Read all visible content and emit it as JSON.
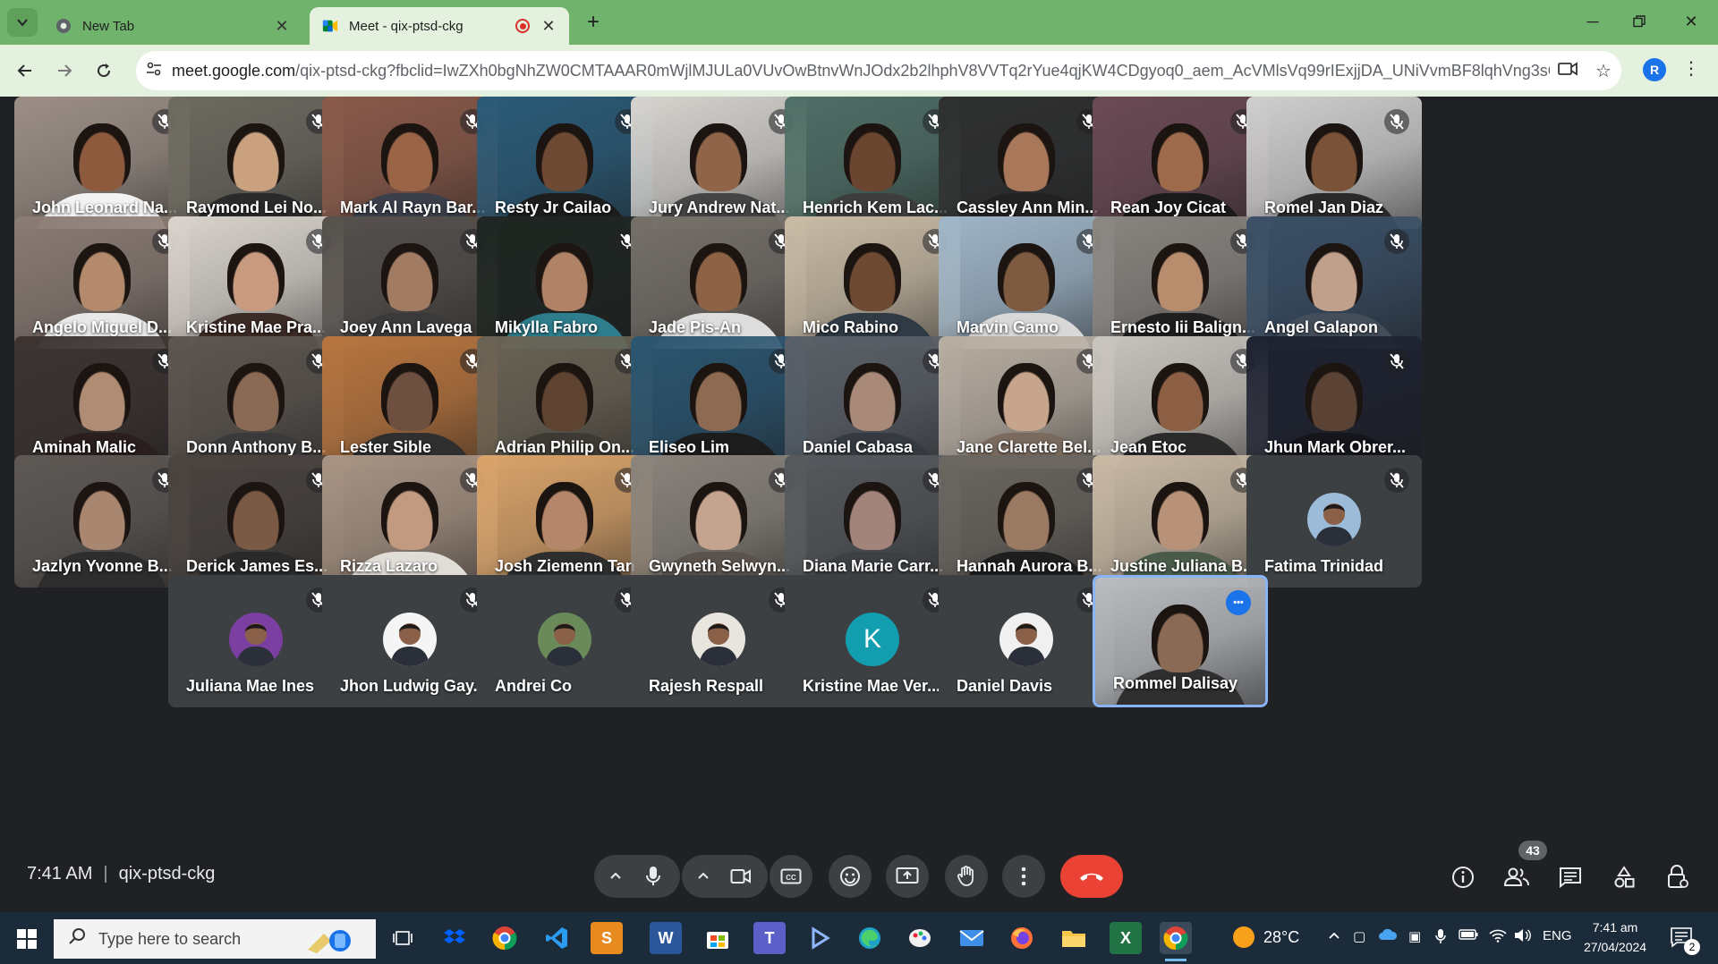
{
  "browser": {
    "tabs": [
      {
        "label": "New Tab",
        "favicon": "chrome-icon"
      },
      {
        "label": "Meet - qix-ptsd-ckg",
        "favicon": "meet-icon",
        "recording": true
      }
    ],
    "url_host": "meet.google.com",
    "url_path": "/qix-ptsd-ckg?fbclid=IwZXh0bgNhZW0CMTAAAR0mWjlMJULa0VUvOwBtnvWnJOdx2b2lhphV8VVTq2rYue4qjKW4CDgyoq0_aem_AcVMlsVq99rIExjjDA_UNiVvmBF8lqhVng3sQmG-K...",
    "profile_initial": "R",
    "accent": "#6fb36c"
  },
  "meeting": {
    "time": "7:41 AM",
    "code": "qix-ptsd-ckg",
    "participant_count": "43"
  },
  "participants": [
    {
      "name": "John Leonard Na...",
      "video": true,
      "bg": "#9c8f86",
      "skin": "#8d5a3d",
      "shirt": "#f2f2f2"
    },
    {
      "name": "Raymond Lei No...",
      "video": true,
      "bg": "#6d6a60",
      "skin": "#c9a17f",
      "shirt": "#2a2a2a"
    },
    {
      "name": "Mark Al Rayn Bar...",
      "video": true,
      "bg": "#8a5a4a",
      "skin": "#9a6446",
      "shirt": "#3a3f4a"
    },
    {
      "name": "Resty Jr Cailao",
      "video": true,
      "bg": "#2b5b78",
      "skin": "#6e4a34",
      "shirt": "#1d1d1d"
    },
    {
      "name": "Jury Andrew Nat...",
      "video": true,
      "bg": "#d7d4cf",
      "skin": "#8f6448",
      "shirt": "#444444"
    },
    {
      "name": "Henrich Kem Lac...",
      "video": true,
      "bg": "#4f6f66",
      "skin": "#6a4530",
      "shirt": "#3d3d3d"
    },
    {
      "name": "Cassley Ann Min...",
      "video": true,
      "bg": "#2f3030",
      "skin": "#a9785a",
      "shirt": "#222222"
    },
    {
      "name": "Rean Joy Cicat",
      "video": true,
      "bg": "#6b4a55",
      "skin": "#9d6a4c",
      "shirt": "#1a1a1a"
    },
    {
      "name": "Romel Jan Diaz",
      "video": true,
      "bg": "#cfcfcf",
      "skin": "#7a5238",
      "shirt": "#2a2a2a"
    },
    {
      "name": "Angelo Miguel D...",
      "video": true,
      "bg": "#8b7c74",
      "skin": "#b38a6b",
      "shirt": "#e8e8e8"
    },
    {
      "name": "Kristine Mae Pra...",
      "video": true,
      "bg": "#d9d3cc",
      "skin": "#c89a80",
      "shirt": "#3b2a25"
    },
    {
      "name": "Joey Ann Lavega",
      "video": true,
      "bg": "#55504c",
      "skin": "#a27b63",
      "shirt": "#3a3a3a"
    },
    {
      "name": "Mikylla Fabro",
      "video": true,
      "bg": "#1f2622",
      "skin": "#b08366",
      "shirt": "#2e7d8c"
    },
    {
      "name": "Jade Pis-An",
      "video": true,
      "bg": "#76706a",
      "skin": "#8e6244",
      "shirt": "#dddddd"
    },
    {
      "name": "Mico Rabino",
      "video": true,
      "bg": "#c9bba5",
      "skin": "#6f4a33",
      "shirt": "#2f3a44"
    },
    {
      "name": "Marvin Gamo",
      "video": true,
      "bg": "#9fb5c7",
      "skin": "#7d5a40",
      "shirt": "#d8d8d8"
    },
    {
      "name": "Ernesto Iii Balign...",
      "video": true,
      "bg": "#8a8580",
      "skin": "#b88d6e",
      "shirt": "#1f1f1f"
    },
    {
      "name": "Angel Galapon",
      "video": true,
      "bg": "#3a4f66",
      "skin": "#c0a08a",
      "shirt": "#444e5a"
    },
    {
      "name": "Aminah Malic",
      "video": true,
      "bg": "#3d3432",
      "skin": "#b18c74",
      "shirt": "#2a1e1e"
    },
    {
      "name": "Donn Anthony B...",
      "video": true,
      "bg": "#5d5650",
      "skin": "#8b6a55",
      "shirt": "#3a3a3a"
    },
    {
      "name": "Lester Sible",
      "video": true,
      "bg": "#b8753f",
      "skin": "#6e5040",
      "shirt": "#2f2f2f"
    },
    {
      "name": "Adrian Philip On...",
      "video": true,
      "bg": "#6a6355",
      "skin": "#5e4430",
      "shirt": "#3c3a33"
    },
    {
      "name": "Eliseo Lim",
      "video": true,
      "bg": "#2b5570",
      "skin": "#8f6a52",
      "shirt": "#1c1c1c"
    },
    {
      "name": "Daniel Cabasa",
      "video": true,
      "bg": "#5b6068",
      "skin": "#a98a78",
      "shirt": "#343a40"
    },
    {
      "name": "Jane Clarette Bel...",
      "video": true,
      "bg": "#b8aea2",
      "skin": "#c7a58c",
      "shirt": "#7a6a5e"
    },
    {
      "name": "Jean Etoc",
      "video": true,
      "bg": "#c9c4be",
      "skin": "#8c5f44",
      "shirt": "#2a2a2a"
    },
    {
      "name": "Jhun Mark Obrer...",
      "video": true,
      "bg": "#1e2230",
      "skin": "#5a4334",
      "shirt": "#15151c"
    },
    {
      "name": "Jazlyn Yvonne B...",
      "video": true,
      "bg": "#5e5955",
      "skin": "#a98670",
      "shirt": "#2d2d2d"
    },
    {
      "name": "Derick James Es...",
      "video": true,
      "bg": "#4a4440",
      "skin": "#7a5a45",
      "shirt": "#2a2a2a"
    },
    {
      "name": "Rizza Lazaro",
      "video": true,
      "bg": "#a89484",
      "skin": "#c29a80",
      "shirt": "#e0dcd6"
    },
    {
      "name": "Josh Ziemenn Tan",
      "video": true,
      "bg": "#d9a36a",
      "skin": "#b5876a",
      "shirt": "#2e2e2e"
    },
    {
      "name": "Gwyneth Selwyn...",
      "video": true,
      "bg": "#8a847c",
      "skin": "#c4a48e",
      "shirt": "#5a524c"
    },
    {
      "name": "Diana Marie Carr...",
      "video": true,
      "bg": "#55585c",
      "skin": "#a3847a",
      "shirt": "#3c3f44"
    },
    {
      "name": "Hannah Aurora B...",
      "video": true,
      "bg": "#6b6660",
      "skin": "#9a7a62",
      "shirt": "#1e1e1e"
    },
    {
      "name": "Justine Juliana B...",
      "video": true,
      "bg": "#c8b9a4",
      "skin": "#b89278",
      "shirt": "#4a5b4a"
    },
    {
      "name": "Fatima Trinidad",
      "video": false,
      "avatar_bg": "#9bbbd9",
      "avatar_letter": ""
    },
    {
      "name": "Juliana Mae Ines",
      "video": false,
      "avatar_bg": "#7a3fa0",
      "avatar_letter": ""
    },
    {
      "name": "Jhon Ludwig Gay...",
      "video": false,
      "avatar_bg": "#f5f5f5",
      "avatar_letter": ""
    },
    {
      "name": "Andrei Co",
      "video": false,
      "avatar_bg": "#6a8a5a",
      "avatar_letter": ""
    },
    {
      "name": "Rajesh Respall",
      "video": false,
      "avatar_bg": "#e8e4de",
      "avatar_letter": ""
    },
    {
      "name": "Kristine Mae Ver...",
      "video": false,
      "avatar_bg": "#129eaf",
      "avatar_letter": "K"
    },
    {
      "name": "Daniel Davis",
      "video": false,
      "avatar_bg": "#f0f0f0",
      "avatar_letter": ""
    },
    {
      "name": "Rommel Dalisay",
      "video": true,
      "self": true,
      "bg": "#b9bcc0",
      "skin": "#8a6a55",
      "shirt": "#2f2f2f"
    }
  ],
  "controls": {
    "captions_icon": "closed-captions-icon",
    "end_call_color": "#ea4335"
  },
  "taskbar": {
    "search_placeholder": "Type here to search",
    "temperature": "28°C",
    "language": "ENG",
    "time": "7:41 am",
    "date": "27/04/2024",
    "notification_count": "2"
  }
}
